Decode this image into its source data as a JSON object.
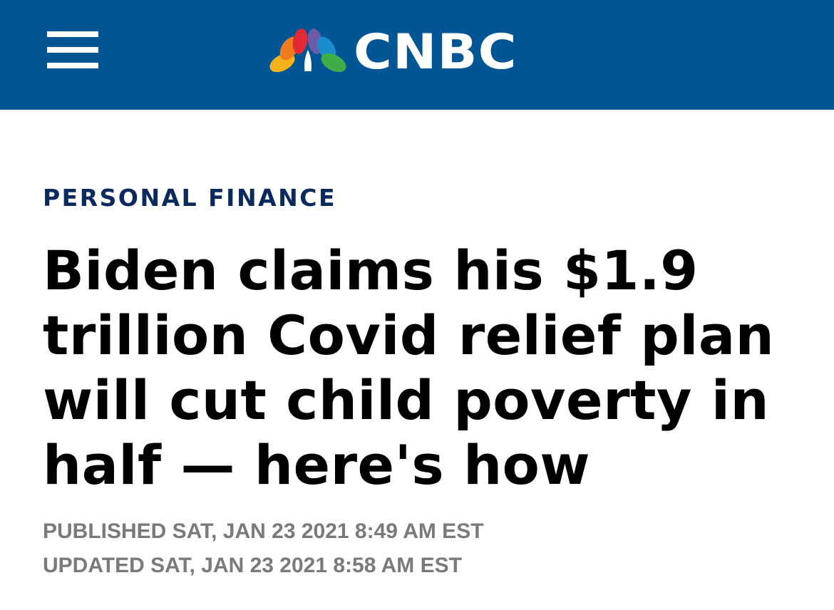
{
  "header": {
    "brand": "CNBC",
    "logo_icon": "cnbc-peacock-icon",
    "menu_icon": "hamburger-menu-icon",
    "background_color": "#005594"
  },
  "article": {
    "section": "PERSONAL FINANCE",
    "headline": "Biden claims his $1.9 trillion Covid relief plan will cut child poverty in half — here's how",
    "published": "PUBLISHED SAT, JAN 23 2021 8:49 AM EST",
    "updated": "UPDATED SAT, JAN 23 2021 8:58 AM EST"
  }
}
